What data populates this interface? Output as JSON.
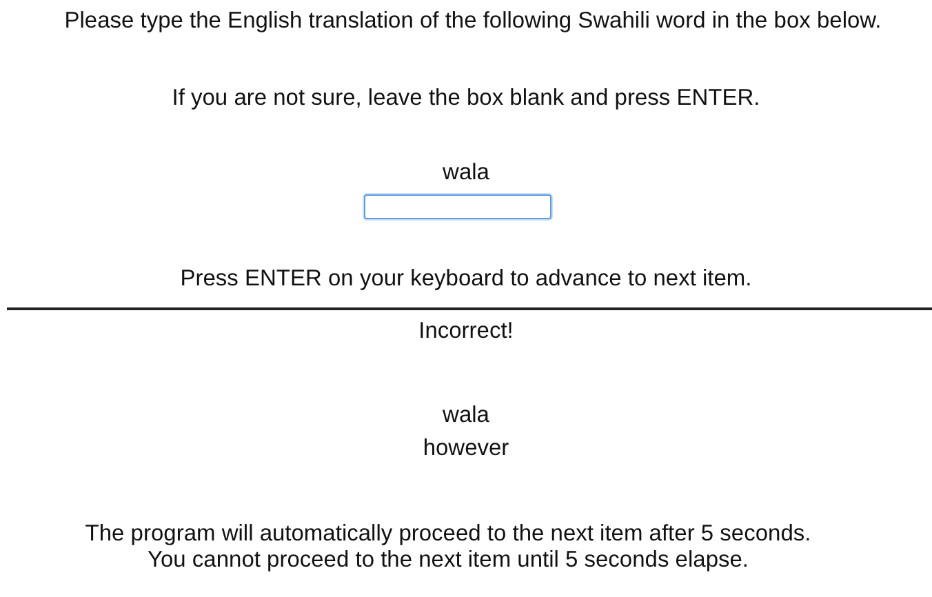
{
  "instructions": [
    "Please type the English translation of the following Swahili word in the box below.",
    "If you are not sure, leave the box blank and press ENTER."
  ],
  "prompt_word": "wala",
  "answer_field": {
    "focused": true
  },
  "advance_hint": "Press ENTER on your keyboard to advance to next item.",
  "feedback": {
    "result": "Incorrect!",
    "word": "wala",
    "translation": "however"
  },
  "notes": [
    "The program will automatically proceed to the next item after 5 seconds.",
    "You cannot proceed to the next item until 5 seconds elapse."
  ]
}
